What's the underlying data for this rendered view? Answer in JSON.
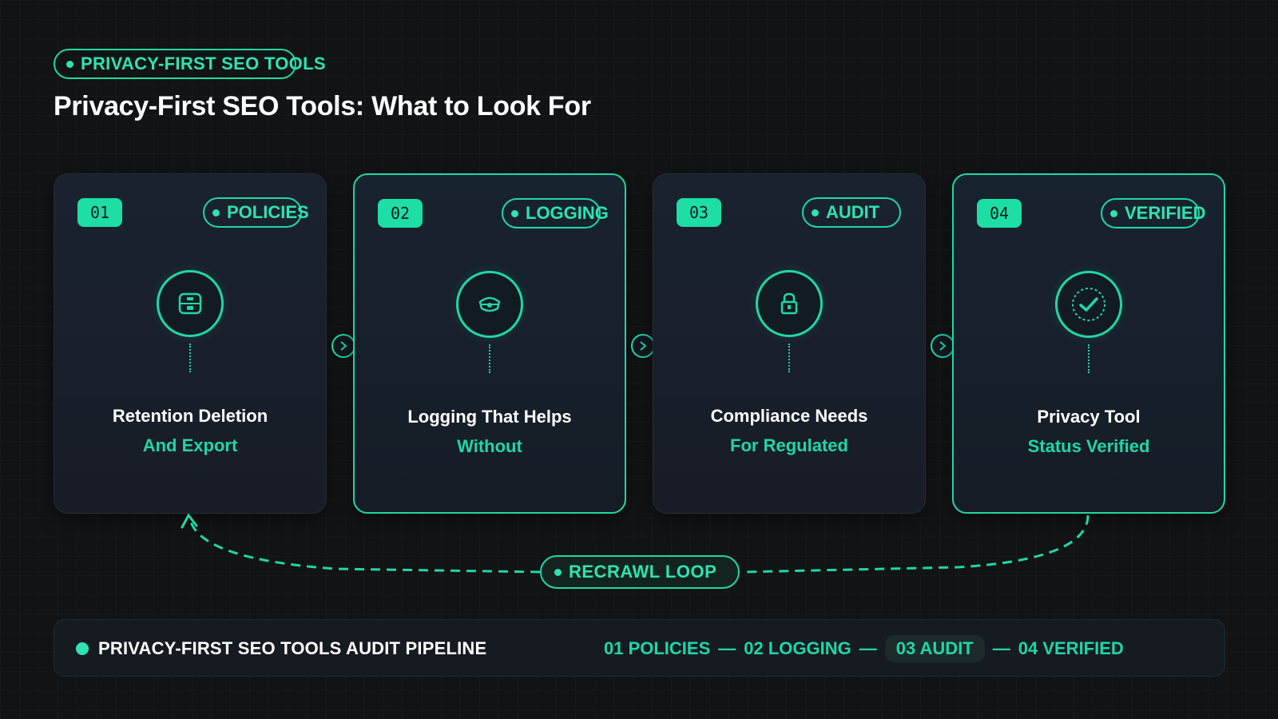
{
  "header": {
    "eyebrow": "PRIVACY-FIRST SEO TOOLS",
    "title": "Privacy-First SEO Tools: What to Look For"
  },
  "cards": [
    {
      "number": "01",
      "tag": "POLICIES",
      "title": "Retention Deletion",
      "subtitle": "And Export",
      "icon": "archive-box-icon",
      "highlighted": false
    },
    {
      "number": "02",
      "tag": "LOGGING",
      "title": "Logging That Helps",
      "subtitle": "Without",
      "icon": "masked-eye-icon",
      "highlighted": true
    },
    {
      "number": "03",
      "tag": "AUDIT",
      "title": "Compliance Needs",
      "subtitle": "For Regulated",
      "icon": "lock-icon",
      "highlighted": false
    },
    {
      "number": "04",
      "tag": "VERIFIED",
      "title": "Privacy Tool",
      "subtitle": "Status Verified",
      "icon": "check-circle-icon",
      "highlighted": true
    }
  ],
  "loop": {
    "label": "RECRAWL LOOP"
  },
  "footer": {
    "label": "PRIVACY-FIRST SEO TOOLS AUDIT PIPELINE",
    "steps": [
      "01 POLICIES",
      "02 LOGGING",
      "03 AUDIT",
      "04 VERIFIED"
    ],
    "separator": "—"
  },
  "colors": {
    "accent": "#1fd7a5",
    "background": "#121314",
    "card": "#1a2230"
  }
}
